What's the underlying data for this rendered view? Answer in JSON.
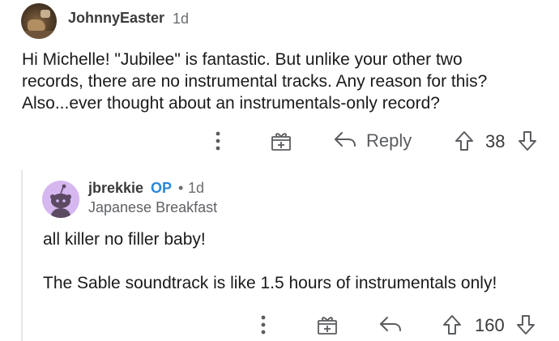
{
  "comment": {
    "username": "JohnnyEaster",
    "time": "1d",
    "body": [
      "Hi Michelle! \"Jubilee\" is fantastic. But unlike your other two",
      "records, there are no instrumental tracks. Any reason for this?",
      "Also...ever thought about an instrumentals-only record?"
    ],
    "actions": {
      "more_icon": "more-vertical-icon",
      "award_icon": "gift-award-icon",
      "reply_icon": "reply-arrow-icon",
      "reply_label": "Reply",
      "upvote_icon": "upvote-arrow-icon",
      "score": "38",
      "downvote_icon": "downvote-arrow-icon"
    }
  },
  "reply": {
    "username": "jbrekkie",
    "op_badge": "OP",
    "separator": "•",
    "time": "1d",
    "flair": "Japanese Breakfast",
    "body": [
      "all killer no filler baby!",
      "The Sable soundtrack is like 1.5 hours of instrumentals only!"
    ],
    "actions": {
      "more_icon": "more-vertical-icon",
      "award_icon": "gift-award-icon",
      "reply_icon": "reply-arrow-icon",
      "upvote_icon": "upvote-arrow-icon",
      "score": "160",
      "downvote_icon": "downvote-arrow-icon"
    }
  },
  "colors": {
    "op_badge": "#2a86d6",
    "avatar_bg": "#d6b7f0",
    "icon": "#5a5c5f",
    "text": "#1a1a1b",
    "meta": "#6b6d70"
  }
}
